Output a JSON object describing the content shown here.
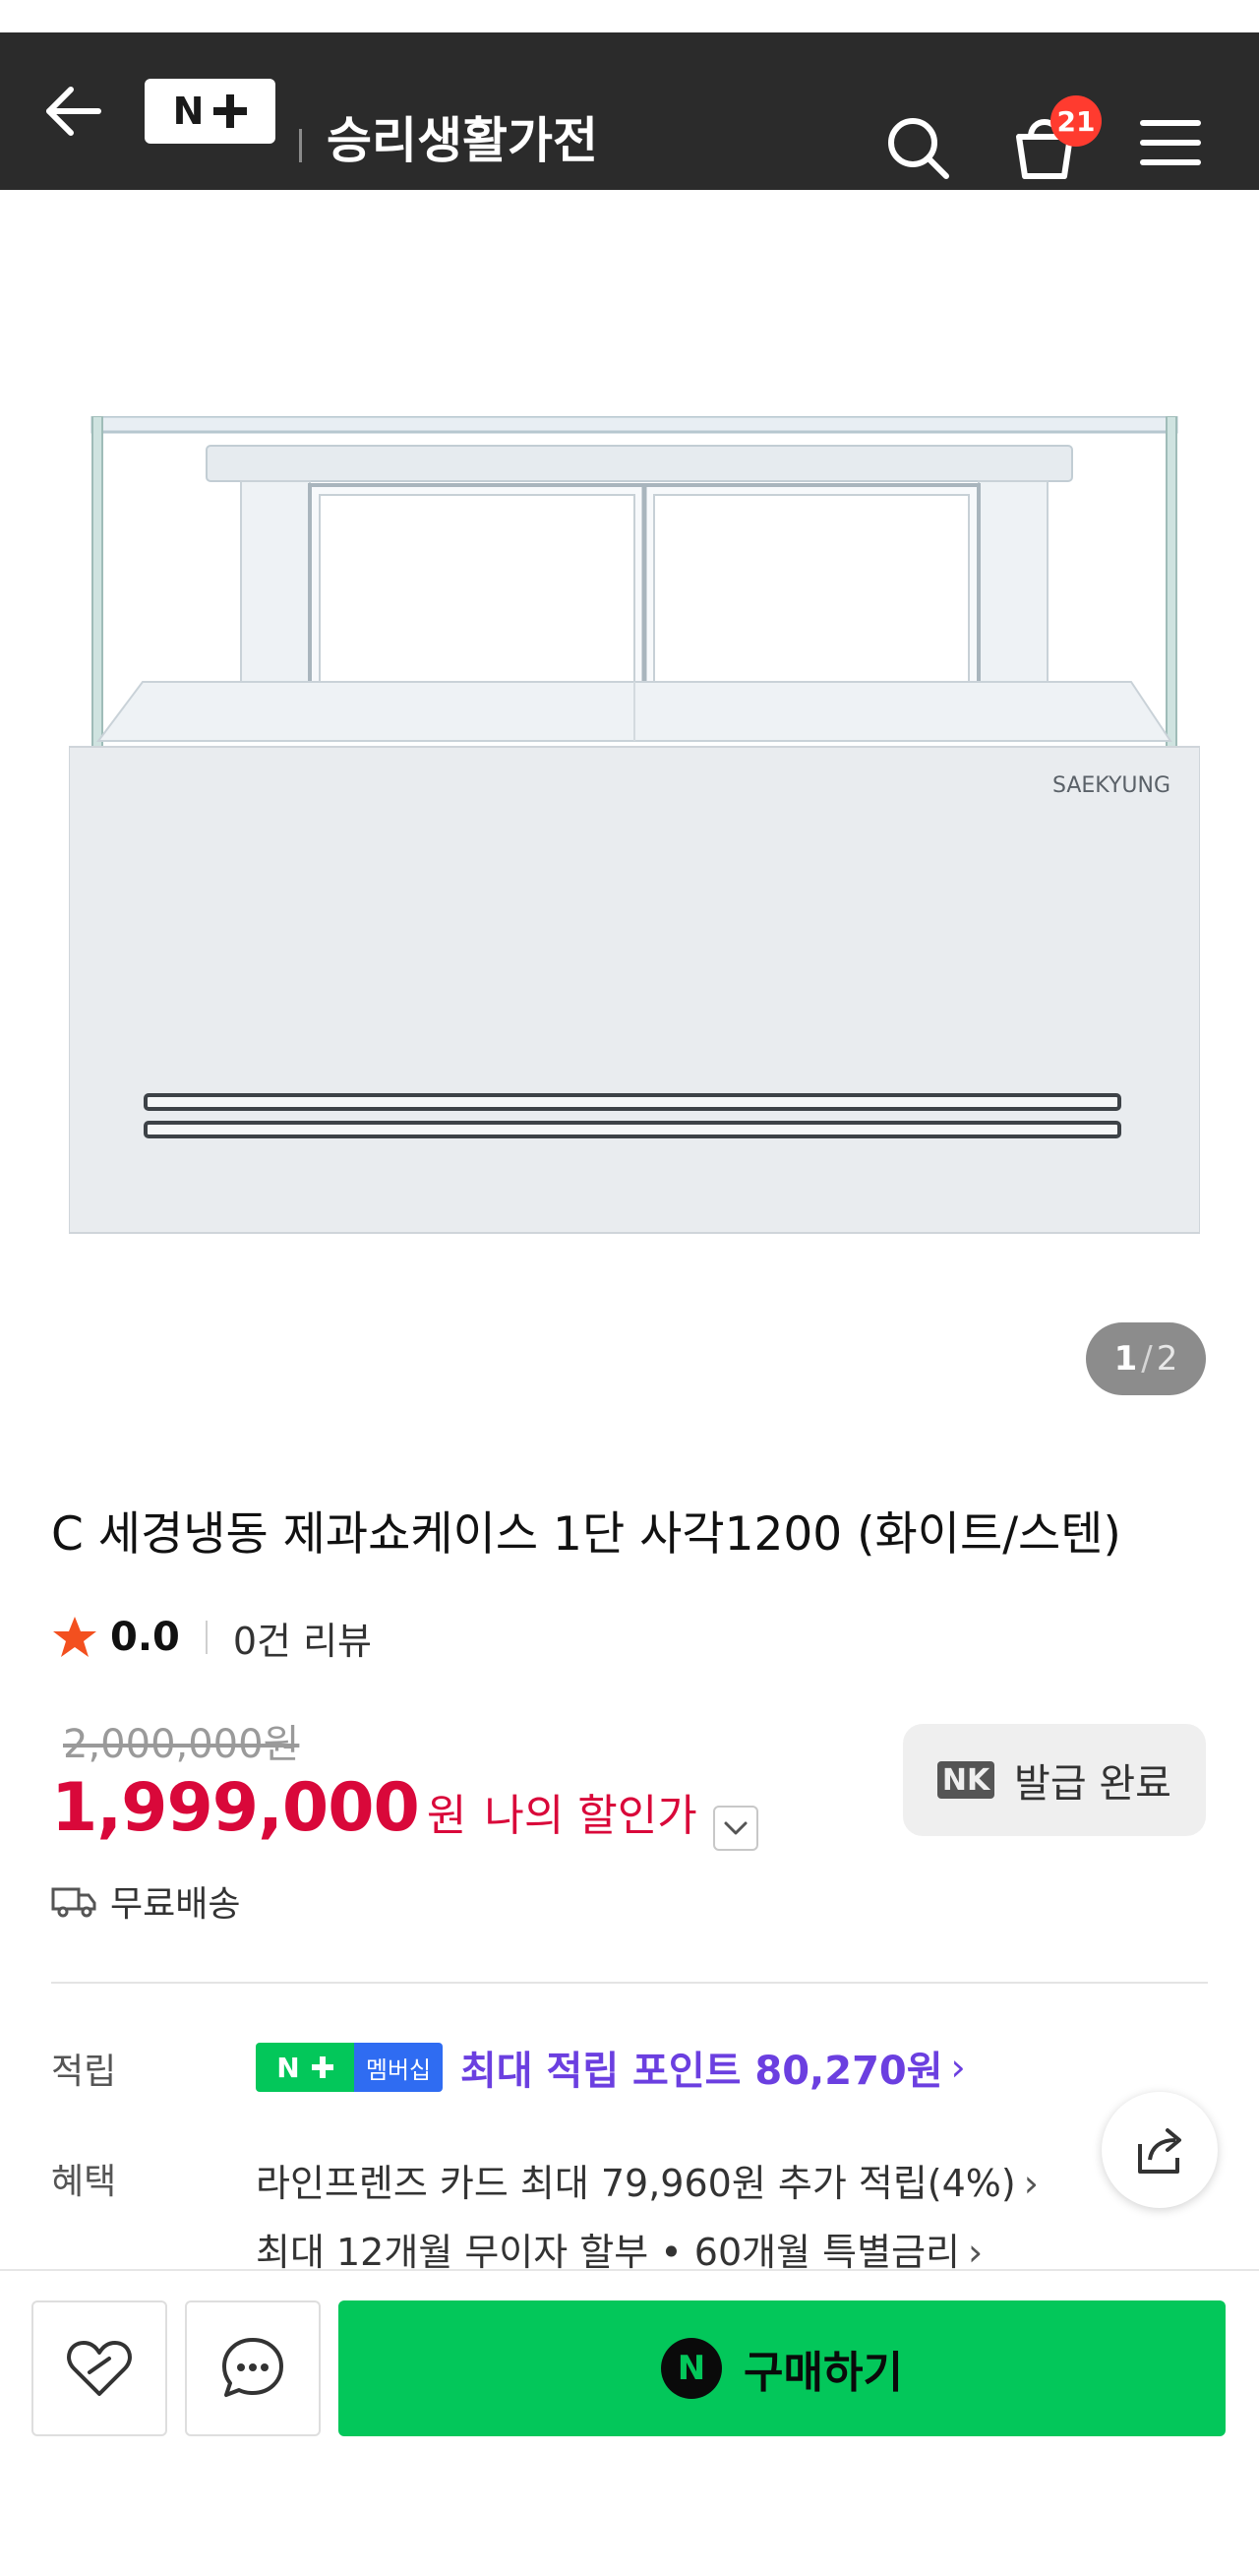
{
  "header": {
    "store_name": "승리생활가전",
    "logo_text": "N",
    "cart_count": "21",
    "colors": {
      "bar": "#2b2b2b",
      "badge": "#ff3b2f"
    }
  },
  "gallery": {
    "brand_mark": "SAEKYUNG",
    "current_page": "1",
    "separator": "/",
    "total_pages": "2"
  },
  "product": {
    "title": "C 세경냉동 제과쇼케이스 1단 사각1200 (화이트/스텐)",
    "rating": "0.0",
    "review_count_text": "0건 리뷰",
    "original_price": "2,000,000원",
    "sale_price": "1,999,000",
    "currency": "원",
    "my_discount_label": "나의 할인가",
    "coupon_icon": "NK",
    "coupon_label": "발급 완료",
    "delivery_label": "무료배송",
    "price_color": "#d9083a"
  },
  "benefits": {
    "points_label": "적립",
    "membership_badge_n": "N",
    "membership_badge_text": "멤버십",
    "points_text": "최대 적립 포인트 80,270원",
    "points_arrow": "›",
    "benefit_label": "혜택",
    "card_benefit": "라인프렌즈 카드 최대 79,960원 추가 적립(4%)",
    "installment_benefit": "최대 12개월 무이자 할부 • 60개월 특별금리",
    "arrow": "›"
  },
  "bottom_bar": {
    "buy_icon": "N",
    "buy_label": "구매하기",
    "buy_color": "#03c75a"
  },
  "icons": [
    "back-arrow-icon",
    "search-icon",
    "cart-icon",
    "menu-icon",
    "star-icon",
    "chevron-down-icon",
    "truck-icon",
    "share-icon",
    "heart-icon",
    "chat-icon"
  ]
}
